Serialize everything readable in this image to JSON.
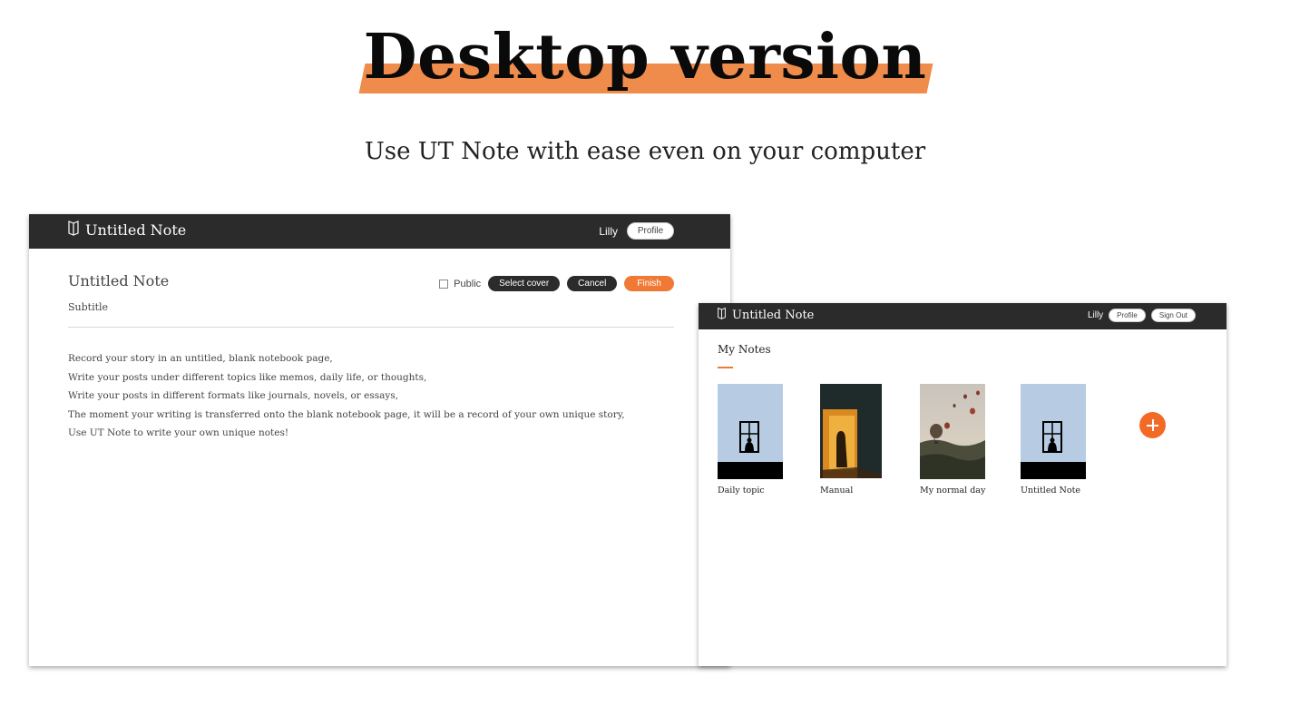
{
  "hero": {
    "title": "Desktop version",
    "subtitle": "Use UT Note with ease even on your computer",
    "highlight_color": "#ef8c4c"
  },
  "editor_window": {
    "topbar": {
      "brand_icon": "notebook-icon",
      "app_title": "Untitled Note",
      "username": "Lilly",
      "profile_label": "Profile"
    },
    "note_title": "Untitled Note",
    "note_subtitle": "Subtitle",
    "actions": {
      "public_label": "Public",
      "public_checked": false,
      "select_cover_label": "Select cover",
      "cancel_label": "Cancel",
      "finish_label": "Finish"
    },
    "body_lines": [
      "Record your story in an untitled, blank notebook page,",
      "Write your posts under different topics like memos, daily life, or thoughts,",
      "Write your posts in different formats like journals, novels, or essays,",
      "The moment your writing is transferred onto the blank notebook page, it will be a record of your own unique story,",
      "Use UT Note to write your own unique notes!"
    ]
  },
  "notes_window": {
    "topbar": {
      "brand_icon": "notebook-icon",
      "app_title": "Untitled Note",
      "username": "Lilly",
      "profile_label": "Profile",
      "signout_label": "Sign Out"
    },
    "heading": "My Notes",
    "notes": [
      {
        "label": "Daily topic",
        "cover": "window-silhouette"
      },
      {
        "label": "Manual",
        "cover": "doorway-silhouette"
      },
      {
        "label": "My normal day",
        "cover": "hot-air-balloons"
      },
      {
        "label": "Untitled Note",
        "cover": "window-silhouette"
      }
    ],
    "add_icon": "plus-icon"
  },
  "colors": {
    "accent": "#f07a35",
    "topbar": "#2b2b2b",
    "cover_blue": "#b7cce3"
  }
}
